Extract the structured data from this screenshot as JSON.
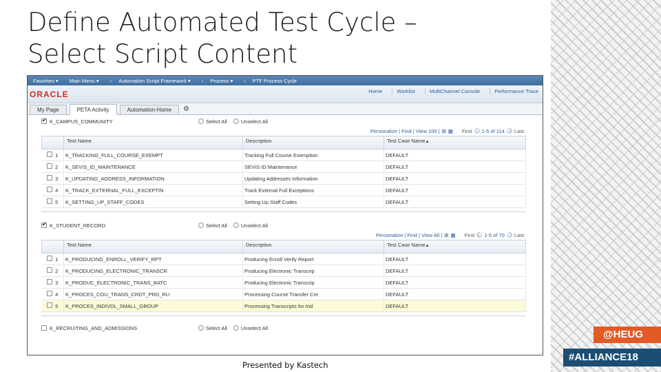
{
  "slide": {
    "title_line1": "Define Automated Test Cycle –",
    "title_line2": "Select Script Content",
    "footer": "Presented by Kastech",
    "badge1": "@HEUG",
    "badge2": "#ALLIANCE18",
    "colors": {
      "badge1_bg": "#e35a24",
      "badge2_bg": "#1c4d73",
      "oracle_red": "#d42a1c",
      "nav_blue": "#4a78aa",
      "link_blue": "#2a5d9a",
      "highlight_row": "#fdfbd6"
    }
  },
  "app": {
    "navbar": {
      "favorites": "Favorites ▾",
      "main_menu": "Main Menu ▾",
      "sep": "›",
      "crumb1": "Automation Script Framework ▾",
      "crumb2": "Process ▾",
      "crumb3": "PTF Process Cycle"
    },
    "logo": "ORACLE",
    "header_links": [
      "Home",
      "Worklist",
      "MultiChannel Console",
      "Performance Trace"
    ],
    "tabs": {
      "my_page": "My Page",
      "peta_activity": "PETA Activity",
      "automation_home": "Automation-Home",
      "gear_icon": "gear-icon"
    },
    "common": {
      "select_all": "Select All",
      "unselect_all": "Unselect All",
      "col_test_name": "Test Name",
      "col_description": "Description",
      "col_test_case": "Test Case Name",
      "sort_icon": "▲"
    },
    "groups": [
      {
        "name": "K_CAMPUS_COMMUNITY",
        "checked": true,
        "grid_links": "Personalize | Find | View 100 |",
        "first": "First",
        "count": "1-5 of 114",
        "last": "Last",
        "rows": [
          {
            "num": "1",
            "name": "K_TRACKING_FULL_COURSE_EXEMPT",
            "desc": "Tracking Full Course Exemption",
            "case": "DEFAULT"
          },
          {
            "num": "2",
            "name": "K_SEVIS_ID_MAINTENANCE",
            "desc": "SEVIS ID Maintenance",
            "case": "DEFAULT"
          },
          {
            "num": "3",
            "name": "K_UPDATING_ADDRESS_INFORMATION",
            "desc": "Updating Addresses Information",
            "case": "DEFAULT"
          },
          {
            "num": "4",
            "name": "K_TRACK_EXTERNAL_FULL_EXCEPTIN",
            "desc": "Track External Full Exceptions",
            "case": "DEFAULT"
          },
          {
            "num": "5",
            "name": "K_SETTING_UP_STAFF_CODES",
            "desc": "Setting Up Staff Codes",
            "case": "DEFAULT"
          }
        ]
      },
      {
        "name": "K_STUDENT_RECORD",
        "checked": true,
        "grid_links": "Personalize | Find | View All |",
        "first": "First",
        "count": "1-5 of 70",
        "last": "Last",
        "rows": [
          {
            "num": "1",
            "name": "K_PRODUCING_ENROLL_VERIFY_RPT",
            "desc": "Producing Enroll Verify Report",
            "case": "DEFAULT"
          },
          {
            "num": "2",
            "name": "K_PRODUCING_ELECTRONIC_TRANSCR",
            "desc": "Producing Electronic Transcrip",
            "case": "DEFAULT"
          },
          {
            "num": "3",
            "name": "K_PRODUC_ELECTRONIC_TRANS_BATC",
            "desc": "Producing Electronic Transcrip",
            "case": "DEFAULT"
          },
          {
            "num": "4",
            "name": "K_PROCES_COU_TRANS_CRDT_PRD_RU",
            "desc": "Processing Course Transfer Cre",
            "case": "DEFAULT"
          },
          {
            "num": "5",
            "name": "K_PROCES_INDIVDL_SMALL_GROUP",
            "desc": "Processing Transcripts for Ind",
            "case": "DEFAULT"
          }
        ]
      },
      {
        "name": "K_RECRUITING_AND_ADMISSIONS",
        "checked": false
      }
    ]
  }
}
